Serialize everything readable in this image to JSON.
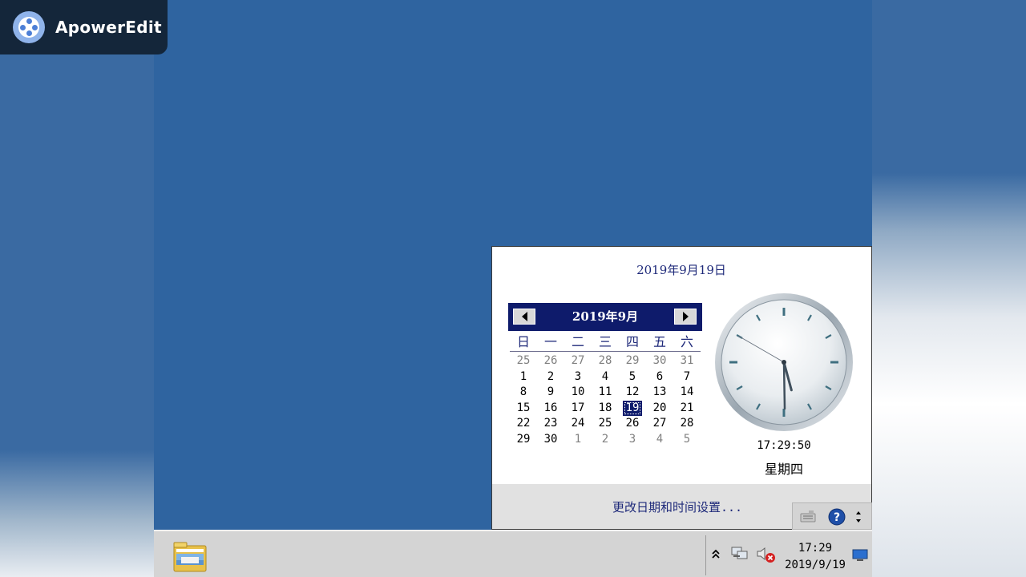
{
  "watermark": {
    "label": "ApowerEdit",
    "icon": "film-reel-icon"
  },
  "flyout": {
    "long_date": "2019年9月19日",
    "calendar": {
      "month_title": "2019年9月",
      "prev_icon": "triangle-left-icon",
      "next_icon": "triangle-right-icon",
      "weekdays": [
        "日",
        "一",
        "二",
        "三",
        "四",
        "五",
        "六"
      ],
      "weeks": [
        [
          "25",
          "26",
          "27",
          "28",
          "29",
          "30",
          "31"
        ],
        [
          "1",
          "2",
          "3",
          "4",
          "5",
          "6",
          "7"
        ],
        [
          "8",
          "9",
          "10",
          "11",
          "12",
          "13",
          "14"
        ],
        [
          "15",
          "16",
          "17",
          "18",
          "19",
          "20",
          "21"
        ],
        [
          "22",
          "23",
          "24",
          "25",
          "26",
          "27",
          "28"
        ],
        [
          "29",
          "30",
          "1",
          "2",
          "3",
          "4",
          "5"
        ]
      ],
      "other_month": [
        [
          true,
          true,
          true,
          true,
          true,
          true,
          true
        ],
        [
          false,
          false,
          false,
          false,
          false,
          false,
          false
        ],
        [
          false,
          false,
          false,
          false,
          false,
          false,
          false
        ],
        [
          false,
          false,
          false,
          false,
          false,
          false,
          false
        ],
        [
          false,
          false,
          false,
          false,
          false,
          false,
          false
        ],
        [
          false,
          false,
          true,
          true,
          true,
          true,
          true
        ]
      ],
      "selected": {
        "week": 3,
        "day": 4
      },
      "selected_color": "#0e1b6b"
    },
    "clock": {
      "hour": 17,
      "minute": 29,
      "second": 50
    },
    "time_text": "17:29:50",
    "weekday_text": "星期四",
    "change_settings_link": "更改日期和时间设置..."
  },
  "taskbar": {
    "pinned": [
      {
        "name": "file-explorer",
        "icon": "folder-icon"
      }
    ],
    "overflow_icons": [
      "keyboard-icon",
      "help-icon",
      "grip-icon"
    ],
    "tray_icons": [
      "show-hidden-chevron-icon",
      "network-icon",
      "volume-muted-icon"
    ],
    "clock_time": "17:29",
    "clock_date": "2019/9/19",
    "show_desktop_icon": "monitor-icon"
  }
}
